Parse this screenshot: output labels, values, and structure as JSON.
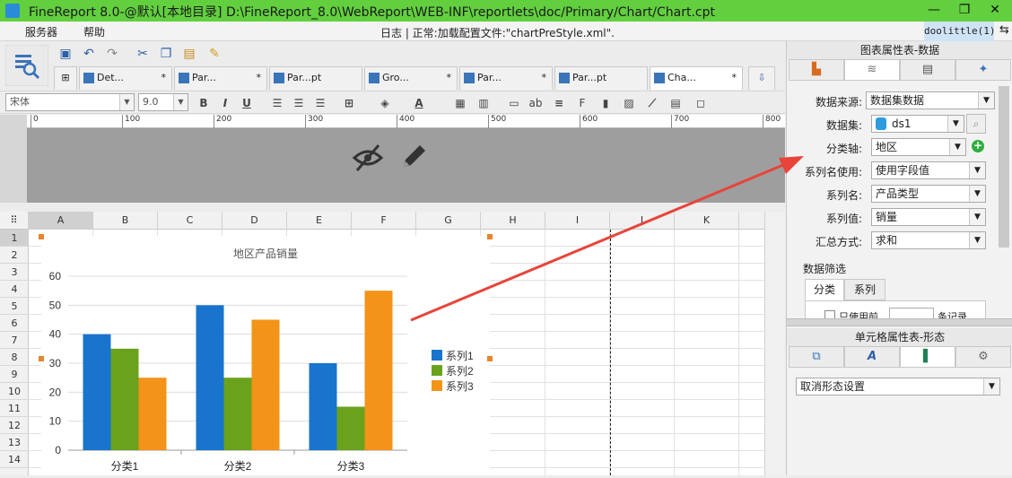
{
  "titlebar": {
    "title": "FineReport 8.0-@默认[本地目录]    D:\\FineReport_8.0\\WebReport\\WEB-INF\\reportlets\\doc/Primary/Chart/Chart.cpt",
    "minimize": "—",
    "restore": "❐",
    "close": "✕",
    "color": "#62cf3f"
  },
  "menubar": {
    "items": [
      "服务器",
      "帮助"
    ],
    "log": "日志 | 正常:加载配置文件:\"chartPreStyle.xml\".",
    "user": "doolittle(1)"
  },
  "tabs": [
    {
      "label": "Det...",
      "close": "*"
    },
    {
      "label": "Par...",
      "close": "*"
    },
    {
      "label": "Par...pt",
      "close": ""
    },
    {
      "label": "Gro...",
      "close": "*"
    },
    {
      "label": "Par...",
      "close": "*"
    },
    {
      "label": "Par...pt",
      "close": ""
    },
    {
      "label": "Cha...",
      "close": "*"
    }
  ],
  "format": {
    "font": "宋体",
    "size": "9.0"
  },
  "ruler": [
    "0",
    "100",
    "200",
    "300",
    "400",
    "500",
    "600",
    "700",
    "800"
  ],
  "columns": [
    "A",
    "B",
    "C",
    "D",
    "E",
    "F",
    "G",
    "H",
    "I",
    "J",
    "K"
  ],
  "rows": [
    "1",
    "2",
    "3",
    "4",
    "5",
    "6",
    "7",
    "8",
    "9",
    "10",
    "11",
    "12",
    "13",
    "14"
  ],
  "chart_data": {
    "type": "bar",
    "title": "地区产品销量",
    "categories": [
      "分类1",
      "分类2",
      "分类3"
    ],
    "series": [
      {
        "name": "系列1",
        "values": [
          40,
          50,
          30
        ],
        "color": "#1874cd"
      },
      {
        "name": "系列2",
        "values": [
          35,
          25,
          15
        ],
        "color": "#6aa21c"
      },
      {
        "name": "系列3",
        "values": [
          25,
          45,
          55
        ],
        "color": "#f39318"
      }
    ],
    "ylim": [
      0,
      60
    ],
    "yticks": [
      "0",
      "10",
      "20",
      "30",
      "40",
      "50",
      "60"
    ],
    "grid": true,
    "legend": "right"
  },
  "panel": {
    "header": "图表属性表-数据",
    "rows": [
      {
        "label": "数据来源:",
        "value": "数据集数据"
      },
      {
        "label": "数据集:",
        "value": "ds1"
      },
      {
        "label": "分类轴:",
        "value": "地区"
      },
      {
        "label": "系列名使用:",
        "value": "使用字段值"
      },
      {
        "label": "系列名:",
        "value": "产品类型"
      },
      {
        "label": "系列值:",
        "value": "销量"
      },
      {
        "label": "汇总方式:",
        "value": "求和"
      }
    ],
    "filter_title": "数据筛选",
    "filter_tabs": [
      "分类",
      "系列"
    ],
    "filter_check": "只使用前",
    "filter_unit": "条记录",
    "header2": "单元格属性表-形态",
    "shape_value": "取消形态设置"
  },
  "accent": "#e8443a"
}
